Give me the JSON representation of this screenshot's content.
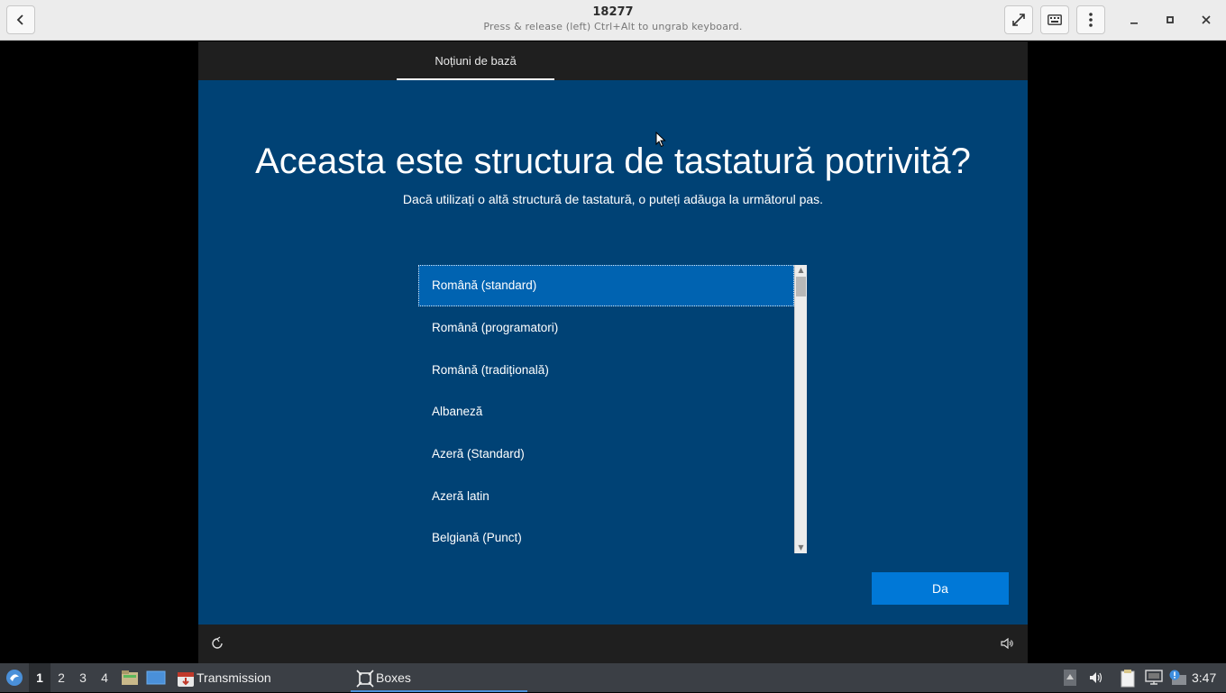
{
  "window": {
    "title": "18277",
    "subtitle": "Press & release (left) Ctrl+Alt to ungrab keyboard.",
    "buttons": {
      "back": "go-back-icon",
      "fullscreen": "fullscreen-icon",
      "keyboard": "keyboard-icon",
      "menu": "menu-icon",
      "minimize": "minimize-icon",
      "maximize": "maximize-icon",
      "close": "close-icon"
    }
  },
  "vm": {
    "tab": "Noțiuni de bază",
    "heading": "Aceasta este structura de tastatură potrivită?",
    "subheading": "Dacă utilizați o altă structură de tastatură, o puteți adăuga la următorul pas.",
    "layouts": [
      "Română (standard)",
      "Română (programatori)",
      "Română (tradițională)",
      "Albaneză",
      "Azeră (Standard)",
      "Azeră latin",
      "Belgiană (Punct)"
    ],
    "selected_index": 0,
    "confirm_button": "Da",
    "colors": {
      "background": "#004275",
      "selection": "#0063b1",
      "button": "#0078d7"
    }
  },
  "taskbar": {
    "workspaces": [
      "1",
      "2",
      "3",
      "4"
    ],
    "active_workspace": "1",
    "tasks": [
      {
        "label": "Transmission",
        "icon": "transmission-icon"
      },
      {
        "label": "Boxes",
        "icon": "boxes-icon"
      }
    ],
    "clock": "3:47"
  }
}
